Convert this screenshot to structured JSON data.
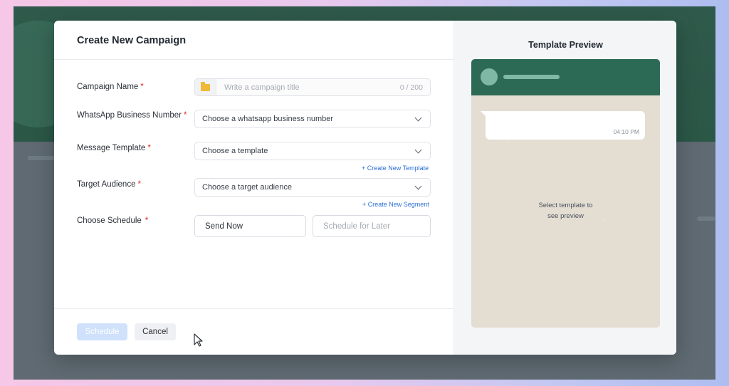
{
  "modal": {
    "title": "Create New Campaign"
  },
  "form": {
    "campaign_name": {
      "label": "Campaign Name",
      "required_mark": "*",
      "placeholder": "Write a campaign title",
      "counter": "0 / 200"
    },
    "business_number": {
      "label": "WhatsApp Business Number",
      "required_mark": "*",
      "selected": "Choose a whatsapp business number"
    },
    "message_template": {
      "label": "Message Template",
      "required_mark": "*",
      "selected": "Choose a template",
      "link": "+ Create New Template"
    },
    "target_audience": {
      "label": "Target Audience",
      "required_mark": "*",
      "selected": "Choose a target audience",
      "link": "+ Create New Segment"
    },
    "schedule": {
      "label": "Choose Schedule",
      "required_mark": "*",
      "send_now": "Send Now",
      "schedule_later": "Schedule for Later"
    }
  },
  "footer": {
    "schedule_label": "Schedule",
    "cancel_label": "Cancel"
  },
  "preview": {
    "title": "Template Preview",
    "time": "04:10 PM",
    "hint_line1": "Select template to",
    "hint_line2": "see preview"
  },
  "colors": {
    "header_green": "#2d6a56",
    "link_blue": "#2b6fd6",
    "required_red": "#e02424",
    "schedule_button": "#cfe1fb"
  },
  "icons": {
    "folder": "folder-icon",
    "chevron": "chevron-down-icon",
    "cursor": "mouse-pointer-icon"
  }
}
